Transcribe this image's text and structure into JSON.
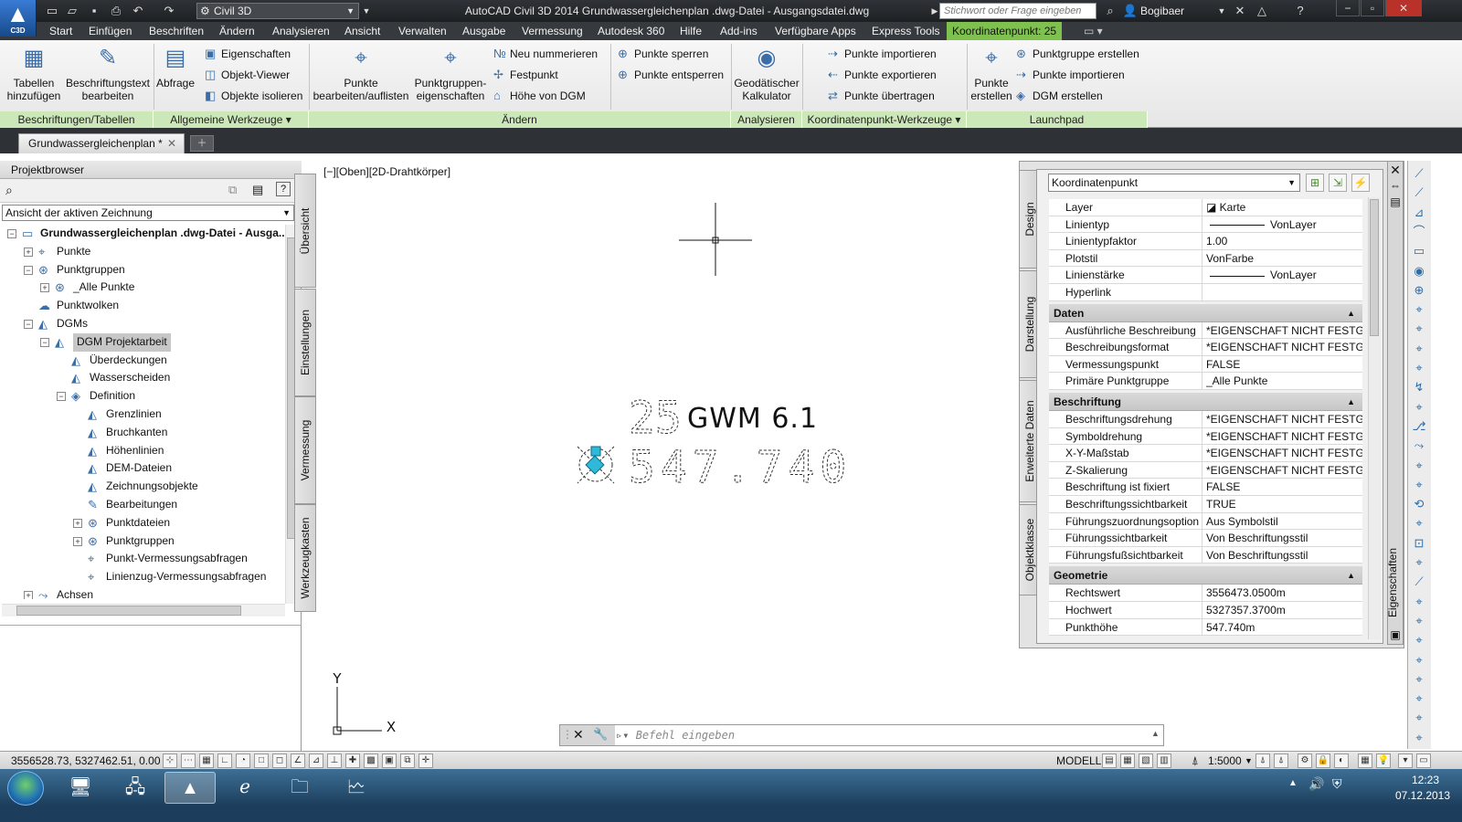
{
  "titlebar": {
    "workspace": "Civil 3D",
    "title": "AutoCAD Civil 3D 2014   Grundwassergleichenplan .dwg-Datei - Ausgangsdatei.dwg",
    "search_placeholder": "Stichwort oder Frage eingeben",
    "user": "Bogibaer",
    "app_logo_text": "C3D"
  },
  "menu": [
    "Start",
    "Einfügen",
    "Beschriften",
    "Ändern",
    "Analysieren",
    "Ansicht",
    "Verwalten",
    "Ausgabe",
    "Vermessung",
    "Autodesk 360",
    "Hilfe",
    "Add-ins",
    "Verfügbare Apps",
    "Express Tools"
  ],
  "context_tab": "Koordinatenpunkt: 25",
  "ribbon": {
    "tabellen": "Tabellen\nhinzufügen",
    "beschriftungstext": "Beschriftungstext\nbearbeiten",
    "abfrage": "Abfrage",
    "eigenschaften": "Eigenschaften",
    "objekt_viewer": "Objekt-Viewer",
    "objekte_isolieren": "Objekte isolieren",
    "punkte_bearbeiten": "Punkte\nbearbeiten/auflisten",
    "punktgruppen_eig": "Punktgruppen-\neigenschaften",
    "neu_nummerieren": "Neu nummerieren",
    "festpunkt": "Festpunkt",
    "hoehe_dgm": "Höhe von DGM",
    "punkte_sperren": "Punkte sperren",
    "punkte_entsperren": "Punkte entsperren",
    "geodaetischer": "Geodätischer\nKalkulator",
    "punkte_importieren": "Punkte importieren",
    "punkte_exportieren": "Punkte exportieren",
    "punkte_uebertragen": "Punkte übertragen",
    "punkte_erstellen": "Punkte\nerstellen",
    "punktgruppe_erstellen": "Punktgruppe erstellen",
    "punkte_importieren2": "Punkte importieren",
    "dgm_erstellen": "DGM erstellen",
    "panels": [
      "Beschriftungen/Tabellen",
      "Allgemeine Werkzeuge ▾",
      "Ändern",
      "Analysieren",
      "Koordinatenpunkt-Werkzeuge ▾",
      "Launchpad"
    ]
  },
  "doc_tab": "Grundwassergleichenplan *",
  "browser": {
    "title": "Projektbrowser",
    "view": "Ansicht der aktiven Zeichnung",
    "tree": [
      {
        "label": "Grundwassergleichenplan .dwg-Datei - Ausga...",
        "level": 1,
        "exp": "−",
        "bold": true,
        "icon": "drawing-icon"
      },
      {
        "label": "Punkte",
        "level": 2,
        "exp": "+",
        "icon": "points-icon"
      },
      {
        "label": "Punktgruppen",
        "level": 2,
        "exp": "−",
        "icon": "point-groups-icon"
      },
      {
        "label": "_Alle Punkte",
        "level": 3,
        "exp": "+",
        "icon": "point-group-icon"
      },
      {
        "label": "Punktwolken",
        "level": 2,
        "exp": "",
        "icon": "point-cloud-icon"
      },
      {
        "label": "DGMs",
        "level": 2,
        "exp": "−",
        "icon": "surfaces-icon"
      },
      {
        "label": "DGM Projektarbeit",
        "level": 3,
        "exp": "−",
        "icon": "surface-icon",
        "sel": true
      },
      {
        "label": "Überdeckungen",
        "level": 4,
        "exp": "",
        "icon": "overlap-icon"
      },
      {
        "label": "Wasserscheiden",
        "level": 4,
        "exp": "",
        "icon": "watershed-icon"
      },
      {
        "label": "Definition",
        "level": 4,
        "exp": "−",
        "icon": "definition-icon"
      },
      {
        "label": "Grenzlinien",
        "level": 5,
        "exp": "",
        "icon": "boundary-icon"
      },
      {
        "label": "Bruchkanten",
        "level": 5,
        "exp": "",
        "icon": "breakline-icon"
      },
      {
        "label": "Höhenlinien",
        "level": 5,
        "exp": "",
        "icon": "contour-icon"
      },
      {
        "label": "DEM-Dateien",
        "level": 5,
        "exp": "",
        "icon": "dem-icon"
      },
      {
        "label": "Zeichnungsobjekte",
        "level": 5,
        "exp": "",
        "icon": "drawing-object-icon"
      },
      {
        "label": "Bearbeitungen",
        "level": 5,
        "exp": "",
        "icon": "edit-icon"
      },
      {
        "label": "Punktdateien",
        "level": 5,
        "exp": "+",
        "icon": "point-file-icon"
      },
      {
        "label": "Punktgruppen",
        "level": 5,
        "exp": "+",
        "icon": "point-groups-icon"
      },
      {
        "label": "Punkt-Vermessungsabfragen",
        "level": 5,
        "exp": "",
        "icon": "survey-query-icon"
      },
      {
        "label": "Linienzug-Vermessungsabfragen",
        "level": 5,
        "exp": "",
        "icon": "figure-query-icon"
      },
      {
        "label": "Achsen",
        "level": 2,
        "exp": "+",
        "icon": "alignment-icon"
      }
    ],
    "side_tabs": [
      "Übersicht",
      "Einstellungen",
      "Vermessung",
      "Werkzeugkasten"
    ]
  },
  "viewport_label": "[−][Oben][2D-Drahtkörper]",
  "point": {
    "number": "25",
    "description": "GWM 6.1",
    "elevation": "547.740"
  },
  "ucs": {
    "x": "X",
    "y": "Y"
  },
  "props": {
    "object_type": "Koordinatenpunkt",
    "side_tabs": [
      "Design",
      "Darstellung",
      "Erweiterte Daten",
      "Objektklasse"
    ],
    "strip_label": "Eigenschaften",
    "general": [
      [
        "Layer",
        "Karte"
      ],
      [
        "Linientyp",
        "VonLayer"
      ],
      [
        "Linientypfaktor",
        "1.00"
      ],
      [
        "Plotstil",
        "VonFarbe"
      ],
      [
        "Linienstärke",
        "VonLayer"
      ],
      [
        "Hyperlink",
        ""
      ]
    ],
    "sections": [
      {
        "title": "Daten",
        "rows": [
          [
            "Ausführliche Beschreibung",
            "*EIGENSCHAFT NICHT FESTGE..."
          ],
          [
            "Beschreibungsformat",
            "*EIGENSCHAFT NICHT FESTGE..."
          ],
          [
            "Vermessungspunkt",
            "FALSE"
          ],
          [
            "Primäre Punktgruppe",
            "_Alle Punkte"
          ]
        ]
      },
      {
        "title": "Beschriftung",
        "rows": [
          [
            "Beschriftungsdrehung",
            "*EIGENSCHAFT NICHT FESTGE..."
          ],
          [
            "Symboldrehung",
            "*EIGENSCHAFT NICHT FESTGE..."
          ],
          [
            "X-Y-Maßstab",
            "*EIGENSCHAFT NICHT FESTGE..."
          ],
          [
            "Z-Skalierung",
            "*EIGENSCHAFT NICHT FESTGE..."
          ],
          [
            "Beschriftung ist fixiert",
            "FALSE"
          ],
          [
            "Beschriftungssichtbarkeit",
            "TRUE"
          ],
          [
            "Führungszuordnungsoption",
            "Aus Symbolstil"
          ],
          [
            "Führungssichtbarkeit",
            "Von Beschriftungsstil"
          ],
          [
            "Führungsfußsichtbarkeit",
            "Von Beschriftungsstil"
          ]
        ]
      },
      {
        "title": "Geometrie",
        "rows": [
          [
            "Rechtswert",
            "3556473.0500m"
          ],
          [
            "Hochwert",
            "5327357.3700m"
          ],
          [
            "Punkthöhe",
            "547.740m"
          ]
        ]
      }
    ]
  },
  "command": {
    "placeholder": "Befehl eingeben"
  },
  "status": {
    "coords": "3556528.73, 5327462.51, 0.00",
    "model": "MODELL",
    "scale": "1:5000"
  },
  "clock": {
    "time": "12:23",
    "date": "07.12.2013"
  }
}
